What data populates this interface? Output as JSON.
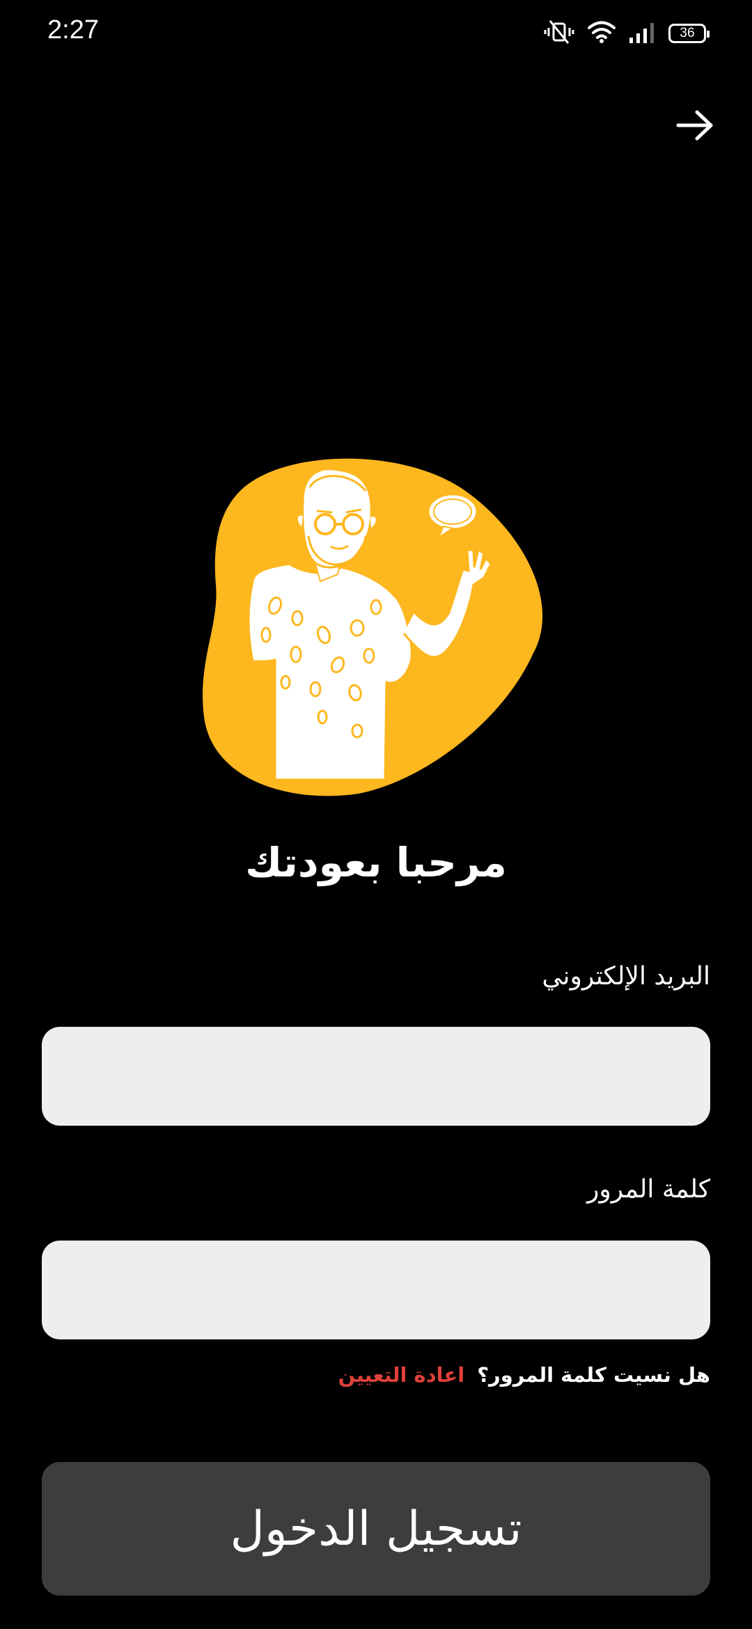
{
  "status_bar": {
    "time": "2:27",
    "battery_level": "36",
    "icons": [
      "vibrate-mute-icon",
      "wifi-icon",
      "signal-icon",
      "battery-icon"
    ]
  },
  "nav": {
    "back_icon": "arrow-right-icon"
  },
  "illustration": {
    "icon": "waving-man-illustration",
    "blob_color": "#FDB71F"
  },
  "title": "مرحبا بعودتك",
  "email": {
    "label": "البريد الإلكتروني",
    "value": "",
    "placeholder": ""
  },
  "password": {
    "label": "كلمة المرور",
    "value": "",
    "placeholder": ""
  },
  "forgot": {
    "question": "هل نسيت كلمة المرور؟",
    "reset_label": "اعادة التعيين",
    "reset_color": "#E0403A"
  },
  "login_button": {
    "label": "تسجيل الدخول",
    "background": "#3D3D3D"
  }
}
